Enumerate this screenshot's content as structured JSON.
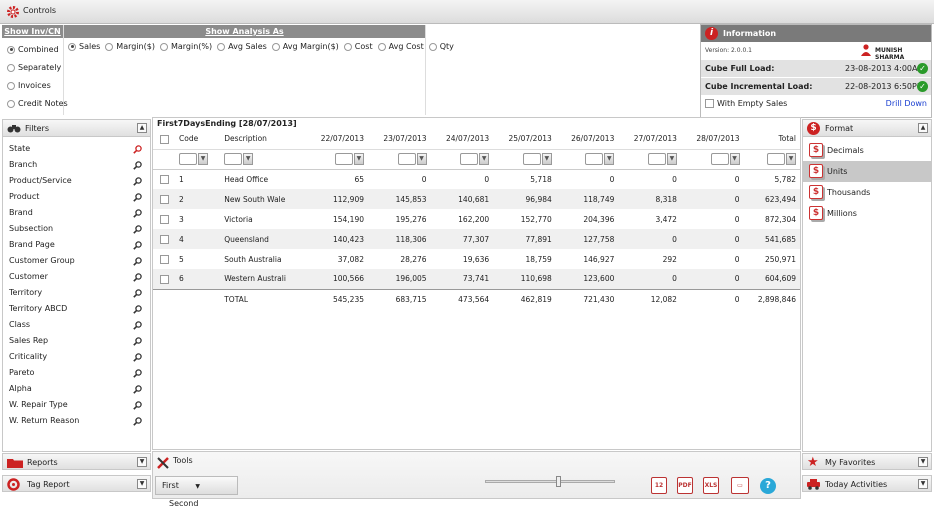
{
  "controls": {
    "title": "Controls"
  },
  "inv_cn": {
    "title": "Show Inv/CN As",
    "options": [
      {
        "label": "Combined",
        "selected": true
      },
      {
        "label": "Separately",
        "selected": false
      },
      {
        "label": "Invoices",
        "selected": false
      },
      {
        "label": "Credit Notes",
        "selected": false
      }
    ]
  },
  "analysis": {
    "title": "Show Analysis As",
    "options": [
      {
        "label": "Sales",
        "selected": true
      },
      {
        "label": "Margin($)",
        "selected": false
      },
      {
        "label": "Margin(%)",
        "selected": false
      },
      {
        "label": "Avg Sales",
        "selected": false
      },
      {
        "label": "Avg Margin($)",
        "selected": false
      },
      {
        "label": "Cost",
        "selected": false
      },
      {
        "label": "Avg Cost",
        "selected": false
      },
      {
        "label": "Qty",
        "selected": false
      }
    ]
  },
  "info": {
    "title": "Information",
    "version": "Version: 2.0.0.1",
    "user": "MUNISH SHARMA",
    "full_load_label": "Cube Full Load:",
    "full_load_value": "23-08-2013 4:00AM",
    "inc_load_label": "Cube Incremental Load:",
    "inc_load_value": "22-08-2013 6:50PM",
    "empty_sales_label": "With Empty Sales",
    "drill_down": "Drill Down"
  },
  "filters": {
    "title": "Filters",
    "items": [
      "State",
      "Branch",
      "Product/Service",
      "Product",
      "Brand",
      "Subsection",
      "Brand Page",
      "Customer Group",
      "Customer",
      "Territory",
      "Territory ABCD",
      "Class",
      "Sales Rep",
      "Criticality",
      "Pareto",
      "Alpha",
      "W. Repair Type",
      "W. Return Reason"
    ]
  },
  "grid": {
    "title": "First7DaysEnding [28/07/2013]",
    "headers": [
      "Code",
      "Description",
      "22/07/2013",
      "23/07/2013",
      "24/07/2013",
      "25/07/2013",
      "26/07/2013",
      "27/07/2013",
      "28/07/2013",
      "Total"
    ],
    "rows": [
      [
        "1",
        "Head Office",
        "65",
        "0",
        "0",
        "5,718",
        "0",
        "0",
        "0",
        "5,782"
      ],
      [
        "2",
        "New South Wale",
        "112,909",
        "145,853",
        "140,681",
        "96,984",
        "118,749",
        "8,318",
        "0",
        "623,494"
      ],
      [
        "3",
        "Victoria",
        "154,190",
        "195,276",
        "162,200",
        "152,770",
        "204,396",
        "3,472",
        "0",
        "872,304"
      ],
      [
        "4",
        "Queensland",
        "140,423",
        "118,306",
        "77,307",
        "77,891",
        "127,758",
        "0",
        "0",
        "541,685"
      ],
      [
        "5",
        "South Australia",
        "37,082",
        "28,276",
        "19,636",
        "18,759",
        "146,927",
        "292",
        "0",
        "250,971"
      ],
      [
        "6",
        "Western Australi",
        "100,566",
        "196,005",
        "73,741",
        "110,698",
        "123,600",
        "0",
        "0",
        "604,609"
      ]
    ],
    "total": [
      "",
      "TOTAL",
      "545,235",
      "683,715",
      "473,564",
      "462,819",
      "721,430",
      "12,082",
      "0",
      "2,898,846"
    ]
  },
  "format": {
    "title": "Format",
    "items": [
      {
        "label": "Decimals",
        "selected": false
      },
      {
        "label": "Units",
        "selected": true
      },
      {
        "label": "Thousands",
        "selected": false
      },
      {
        "label": "Millions",
        "selected": false
      }
    ]
  },
  "reports": {
    "title": "Reports"
  },
  "tag_report": {
    "title": "Tag Report"
  },
  "tools": {
    "title": "Tools",
    "first": "First",
    "second": "Second",
    "slider_level": 0.55
  },
  "favorites": {
    "title": "My Favorites"
  },
  "today": {
    "title": "Today Activities"
  },
  "colors": {
    "accent_red": "#cc2222",
    "header_gray": "#8c8c8c",
    "info_gray": "#7a7a7a",
    "link_blue": "#1a3fd0",
    "ok_green": "#2a9a2a"
  }
}
